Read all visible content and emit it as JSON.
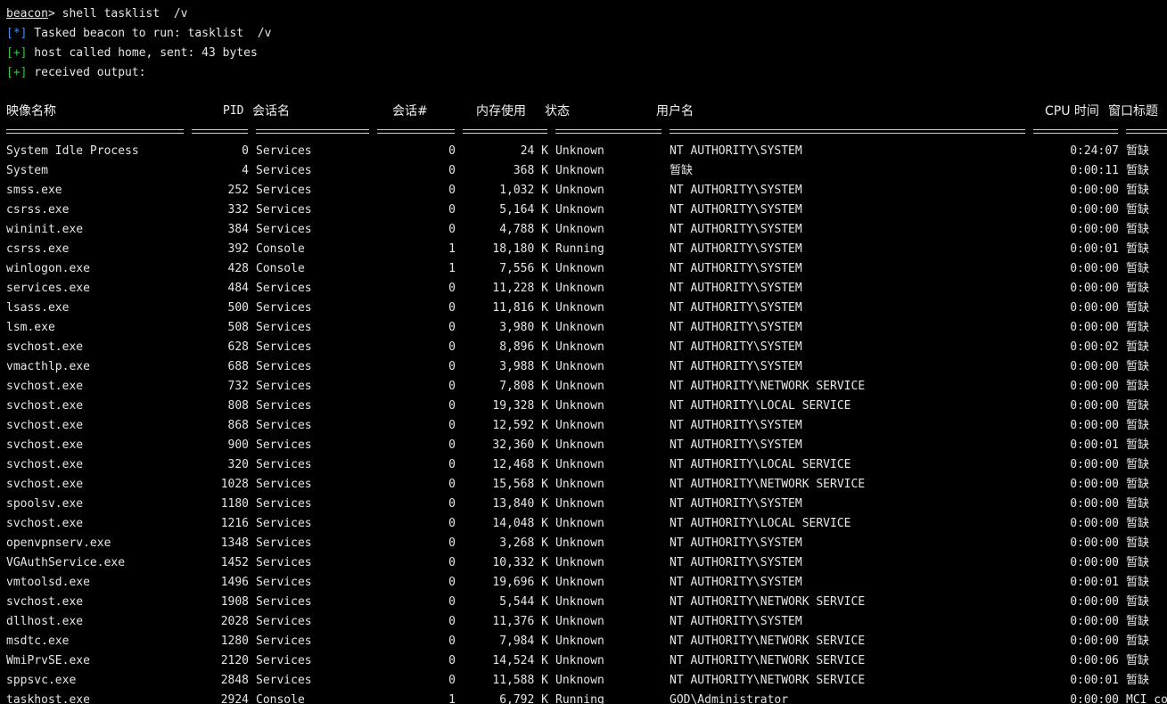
{
  "console": {
    "prompt": "beacon",
    "command": "> shell tasklist  /v",
    "lines": [
      {
        "tag": "[*]",
        "text": " Tasked beacon to run: tasklist  /v"
      },
      {
        "tag": "[+]",
        "text": " host called home, sent: 43 bytes"
      },
      {
        "tag": "[+]",
        "text": " received output:"
      }
    ]
  },
  "table": {
    "headers": {
      "image": "映像名称",
      "pid": "PID",
      "session_name": "会话名",
      "session_num": "会话#",
      "mem": "内存使用",
      "status": "状态",
      "user": "用户名",
      "cpu": "CPU 时间",
      "window": "窗口标题"
    },
    "rows": [
      {
        "image": "System Idle Process",
        "pid": "0",
        "session_name": "Services",
        "session_num": "0",
        "mem": "24 K",
        "status": "Unknown",
        "user": "NT AUTHORITY\\SYSTEM",
        "cpu": "0:24:07",
        "window": "暂缺"
      },
      {
        "image": "System",
        "pid": "4",
        "session_name": "Services",
        "session_num": "0",
        "mem": "368 K",
        "status": "Unknown",
        "user": "暂缺",
        "cpu": "0:00:11",
        "window": "暂缺"
      },
      {
        "image": "smss.exe",
        "pid": "252",
        "session_name": "Services",
        "session_num": "0",
        "mem": "1,032 K",
        "status": "Unknown",
        "user": "NT AUTHORITY\\SYSTEM",
        "cpu": "0:00:00",
        "window": "暂缺"
      },
      {
        "image": "csrss.exe",
        "pid": "332",
        "session_name": "Services",
        "session_num": "0",
        "mem": "5,164 K",
        "status": "Unknown",
        "user": "NT AUTHORITY\\SYSTEM",
        "cpu": "0:00:00",
        "window": "暂缺"
      },
      {
        "image": "wininit.exe",
        "pid": "384",
        "session_name": "Services",
        "session_num": "0",
        "mem": "4,788 K",
        "status": "Unknown",
        "user": "NT AUTHORITY\\SYSTEM",
        "cpu": "0:00:00",
        "window": "暂缺"
      },
      {
        "image": "csrss.exe",
        "pid": "392",
        "session_name": "Console",
        "session_num": "1",
        "mem": "18,180 K",
        "status": "Running",
        "user": "NT AUTHORITY\\SYSTEM",
        "cpu": "0:00:01",
        "window": "暂缺"
      },
      {
        "image": "winlogon.exe",
        "pid": "428",
        "session_name": "Console",
        "session_num": "1",
        "mem": "7,556 K",
        "status": "Unknown",
        "user": "NT AUTHORITY\\SYSTEM",
        "cpu": "0:00:00",
        "window": "暂缺"
      },
      {
        "image": "services.exe",
        "pid": "484",
        "session_name": "Services",
        "session_num": "0",
        "mem": "11,228 K",
        "status": "Unknown",
        "user": "NT AUTHORITY\\SYSTEM",
        "cpu": "0:00:00",
        "window": "暂缺"
      },
      {
        "image": "lsass.exe",
        "pid": "500",
        "session_name": "Services",
        "session_num": "0",
        "mem": "11,816 K",
        "status": "Unknown",
        "user": "NT AUTHORITY\\SYSTEM",
        "cpu": "0:00:00",
        "window": "暂缺"
      },
      {
        "image": "lsm.exe",
        "pid": "508",
        "session_name": "Services",
        "session_num": "0",
        "mem": "3,980 K",
        "status": "Unknown",
        "user": "NT AUTHORITY\\SYSTEM",
        "cpu": "0:00:00",
        "window": "暂缺"
      },
      {
        "image": "svchost.exe",
        "pid": "628",
        "session_name": "Services",
        "session_num": "0",
        "mem": "8,896 K",
        "status": "Unknown",
        "user": "NT AUTHORITY\\SYSTEM",
        "cpu": "0:00:02",
        "window": "暂缺"
      },
      {
        "image": "vmacthlp.exe",
        "pid": "688",
        "session_name": "Services",
        "session_num": "0",
        "mem": "3,988 K",
        "status": "Unknown",
        "user": "NT AUTHORITY\\SYSTEM",
        "cpu": "0:00:00",
        "window": "暂缺"
      },
      {
        "image": "svchost.exe",
        "pid": "732",
        "session_name": "Services",
        "session_num": "0",
        "mem": "7,808 K",
        "status": "Unknown",
        "user": "NT AUTHORITY\\NETWORK SERVICE",
        "cpu": "0:00:00",
        "window": "暂缺"
      },
      {
        "image": "svchost.exe",
        "pid": "808",
        "session_name": "Services",
        "session_num": "0",
        "mem": "19,328 K",
        "status": "Unknown",
        "user": "NT AUTHORITY\\LOCAL SERVICE",
        "cpu": "0:00:00",
        "window": "暂缺"
      },
      {
        "image": "svchost.exe",
        "pid": "868",
        "session_name": "Services",
        "session_num": "0",
        "mem": "12,592 K",
        "status": "Unknown",
        "user": "NT AUTHORITY\\SYSTEM",
        "cpu": "0:00:00",
        "window": "暂缺"
      },
      {
        "image": "svchost.exe",
        "pid": "900",
        "session_name": "Services",
        "session_num": "0",
        "mem": "32,360 K",
        "status": "Unknown",
        "user": "NT AUTHORITY\\SYSTEM",
        "cpu": "0:00:01",
        "window": "暂缺"
      },
      {
        "image": "svchost.exe",
        "pid": "320",
        "session_name": "Services",
        "session_num": "0",
        "mem": "12,468 K",
        "status": "Unknown",
        "user": "NT AUTHORITY\\LOCAL SERVICE",
        "cpu": "0:00:00",
        "window": "暂缺"
      },
      {
        "image": "svchost.exe",
        "pid": "1028",
        "session_name": "Services",
        "session_num": "0",
        "mem": "15,568 K",
        "status": "Unknown",
        "user": "NT AUTHORITY\\NETWORK SERVICE",
        "cpu": "0:00:00",
        "window": "暂缺"
      },
      {
        "image": "spoolsv.exe",
        "pid": "1180",
        "session_name": "Services",
        "session_num": "0",
        "mem": "13,840 K",
        "status": "Unknown",
        "user": "NT AUTHORITY\\SYSTEM",
        "cpu": "0:00:00",
        "window": "暂缺"
      },
      {
        "image": "svchost.exe",
        "pid": "1216",
        "session_name": "Services",
        "session_num": "0",
        "mem": "14,048 K",
        "status": "Unknown",
        "user": "NT AUTHORITY\\LOCAL SERVICE",
        "cpu": "0:00:00",
        "window": "暂缺"
      },
      {
        "image": "openvpnserv.exe",
        "pid": "1348",
        "session_name": "Services",
        "session_num": "0",
        "mem": "3,268 K",
        "status": "Unknown",
        "user": "NT AUTHORITY\\SYSTEM",
        "cpu": "0:00:00",
        "window": "暂缺"
      },
      {
        "image": "VGAuthService.exe",
        "pid": "1452",
        "session_name": "Services",
        "session_num": "0",
        "mem": "10,332 K",
        "status": "Unknown",
        "user": "NT AUTHORITY\\SYSTEM",
        "cpu": "0:00:00",
        "window": "暂缺"
      },
      {
        "image": "vmtoolsd.exe",
        "pid": "1496",
        "session_name": "Services",
        "session_num": "0",
        "mem": "19,696 K",
        "status": "Unknown",
        "user": "NT AUTHORITY\\SYSTEM",
        "cpu": "0:00:01",
        "window": "暂缺"
      },
      {
        "image": "svchost.exe",
        "pid": "1908",
        "session_name": "Services",
        "session_num": "0",
        "mem": "5,544 K",
        "status": "Unknown",
        "user": "NT AUTHORITY\\NETWORK SERVICE",
        "cpu": "0:00:00",
        "window": "暂缺"
      },
      {
        "image": "dllhost.exe",
        "pid": "2028",
        "session_name": "Services",
        "session_num": "0",
        "mem": "11,376 K",
        "status": "Unknown",
        "user": "NT AUTHORITY\\SYSTEM",
        "cpu": "0:00:00",
        "window": "暂缺"
      },
      {
        "image": "msdtc.exe",
        "pid": "1280",
        "session_name": "Services",
        "session_num": "0",
        "mem": "7,984 K",
        "status": "Unknown",
        "user": "NT AUTHORITY\\NETWORK SERVICE",
        "cpu": "0:00:00",
        "window": "暂缺"
      },
      {
        "image": "WmiPrvSE.exe",
        "pid": "2120",
        "session_name": "Services",
        "session_num": "0",
        "mem": "14,524 K",
        "status": "Unknown",
        "user": "NT AUTHORITY\\NETWORK SERVICE",
        "cpu": "0:00:06",
        "window": "暂缺"
      },
      {
        "image": "sppsvc.exe",
        "pid": "2848",
        "session_name": "Services",
        "session_num": "0",
        "mem": "11,588 K",
        "status": "Unknown",
        "user": "NT AUTHORITY\\NETWORK SERVICE",
        "cpu": "0:00:01",
        "window": "暂缺"
      },
      {
        "image": "taskhost.exe",
        "pid": "2924",
        "session_name": "Console",
        "session_num": "1",
        "mem": "6,792 K",
        "status": "Running",
        "user": "GOD\\Administrator",
        "cpu": "0:00:00",
        "window": "MCI co"
      }
    ]
  }
}
